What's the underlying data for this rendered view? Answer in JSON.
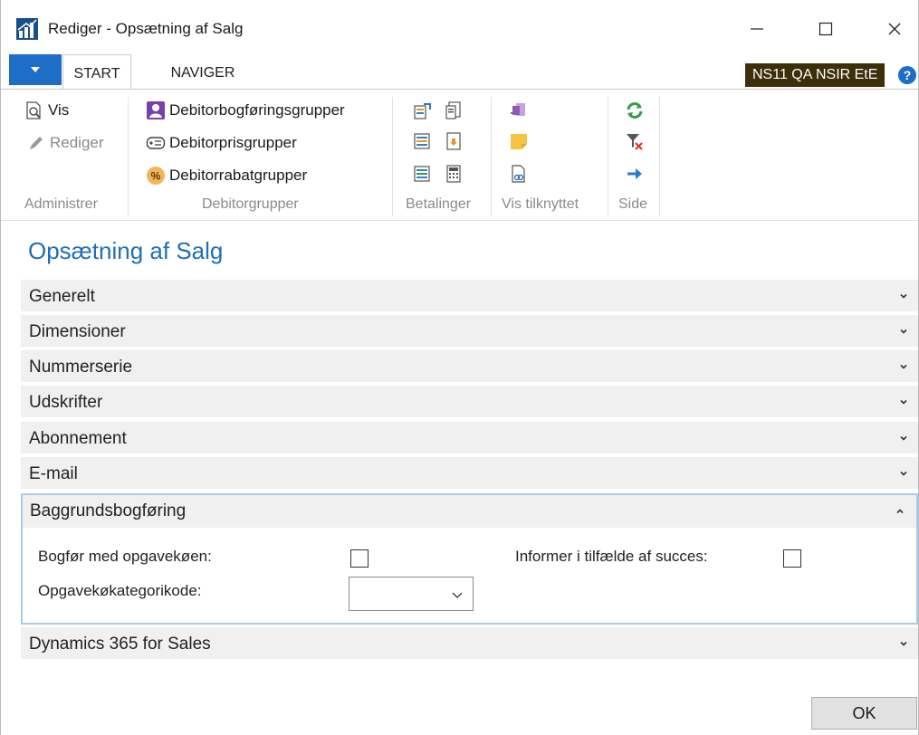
{
  "window": {
    "title": "Rediger - Opsætning af Salg"
  },
  "tabs": {
    "start": "START",
    "navigate": "NAVIGER"
  },
  "company": "NS11 QA NSIR EtE",
  "ribbon": {
    "administer": {
      "label": "Administrer",
      "view": "Vis",
      "edit": "Rediger"
    },
    "customer_groups": {
      "label": "Debitorgrupper",
      "posting_groups": "Debitorbogføringsgrupper",
      "price_groups": "Debitorprisgrupper",
      "discount_groups": "Debitorrabatgrupper"
    },
    "payments": {
      "label": "Betalinger"
    },
    "show_attached": {
      "label": "Vis tilknyttet"
    },
    "page": {
      "label": "Side"
    }
  },
  "page": {
    "title": "Opsætning af Salg"
  },
  "fasttabs": [
    {
      "label": "Generelt"
    },
    {
      "label": "Dimensioner"
    },
    {
      "label": "Nummerserie"
    },
    {
      "label": "Udskrifter"
    },
    {
      "label": "Abonnement"
    },
    {
      "label": "E-mail"
    }
  ],
  "background_posting": {
    "label": "Baggrundsbogføring",
    "post_with_job_queue_label": "Bogfør med opgavekøen:",
    "post_with_job_queue": false,
    "notify_on_success_label": "Informer i tilfælde af succes:",
    "notify_on_success": false,
    "job_queue_category_label": "Opgavekøkategorikode:",
    "job_queue_category_value": ""
  },
  "dynamics_tab": {
    "label": "Dynamics 365 for Sales"
  },
  "buttons": {
    "ok": "OK"
  },
  "colors": {
    "accent_blue": "#1e6dc6",
    "title_blue": "#1f6fb5",
    "badge_bg": "#3c2f0a",
    "panel_border": "#a8cbea"
  }
}
